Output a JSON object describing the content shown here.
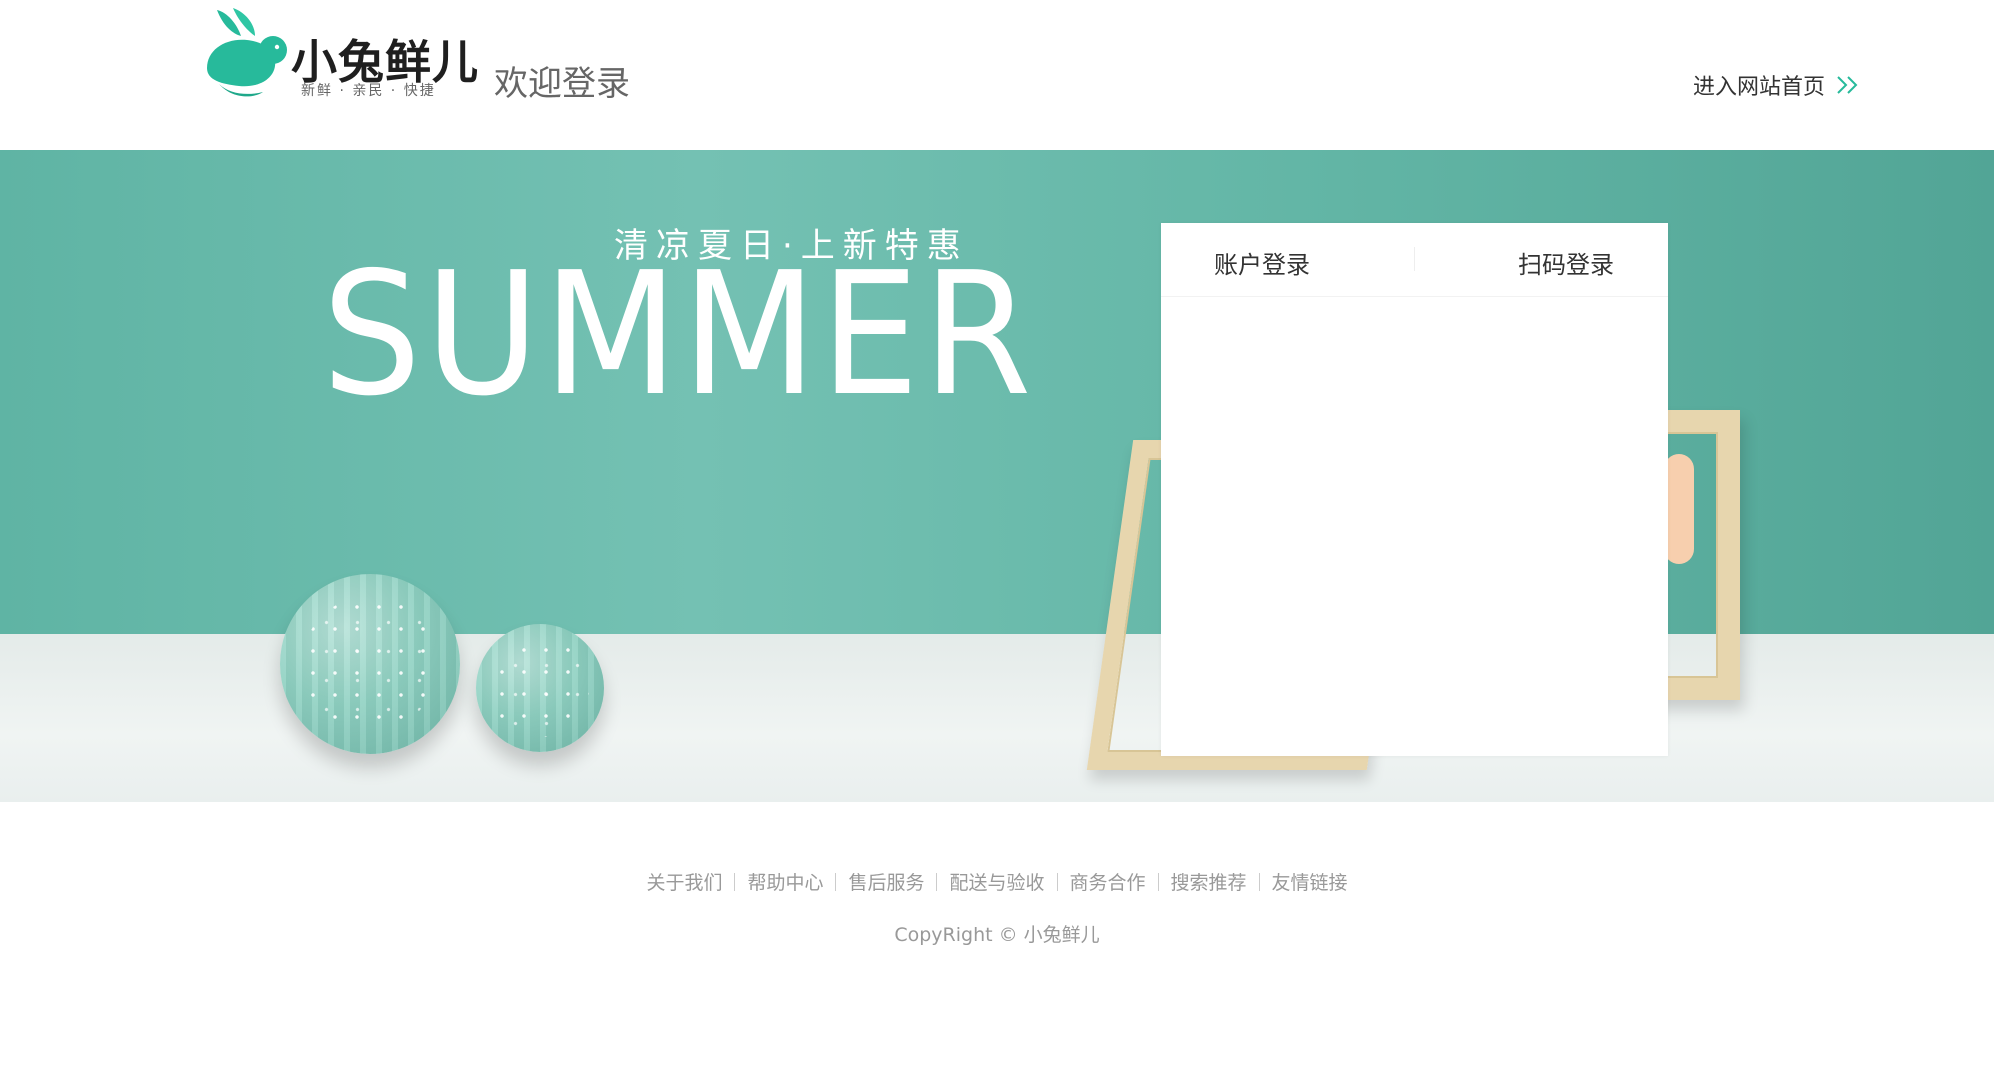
{
  "header": {
    "logo": {
      "name": "小兔鲜儿",
      "slogan": "新鲜 · 亲民 · 快捷"
    },
    "welcome_text": "欢迎登录",
    "home_link_label": "进入网站首页",
    "accent_color": "#27ba9b"
  },
  "banner": {
    "subtitle": "清凉夏日·上新特惠",
    "title": "SUMMER"
  },
  "login": {
    "tabs": [
      {
        "label": "账户登录"
      },
      {
        "label": "扫码登录"
      }
    ]
  },
  "footer": {
    "links": [
      {
        "label": "关于我们"
      },
      {
        "label": "帮助中心"
      },
      {
        "label": "售后服务"
      },
      {
        "label": "配送与验收"
      },
      {
        "label": "商务合作"
      },
      {
        "label": "搜索推荐"
      },
      {
        "label": "友情链接"
      }
    ],
    "copyright": "CopyRight © 小兔鲜儿"
  }
}
